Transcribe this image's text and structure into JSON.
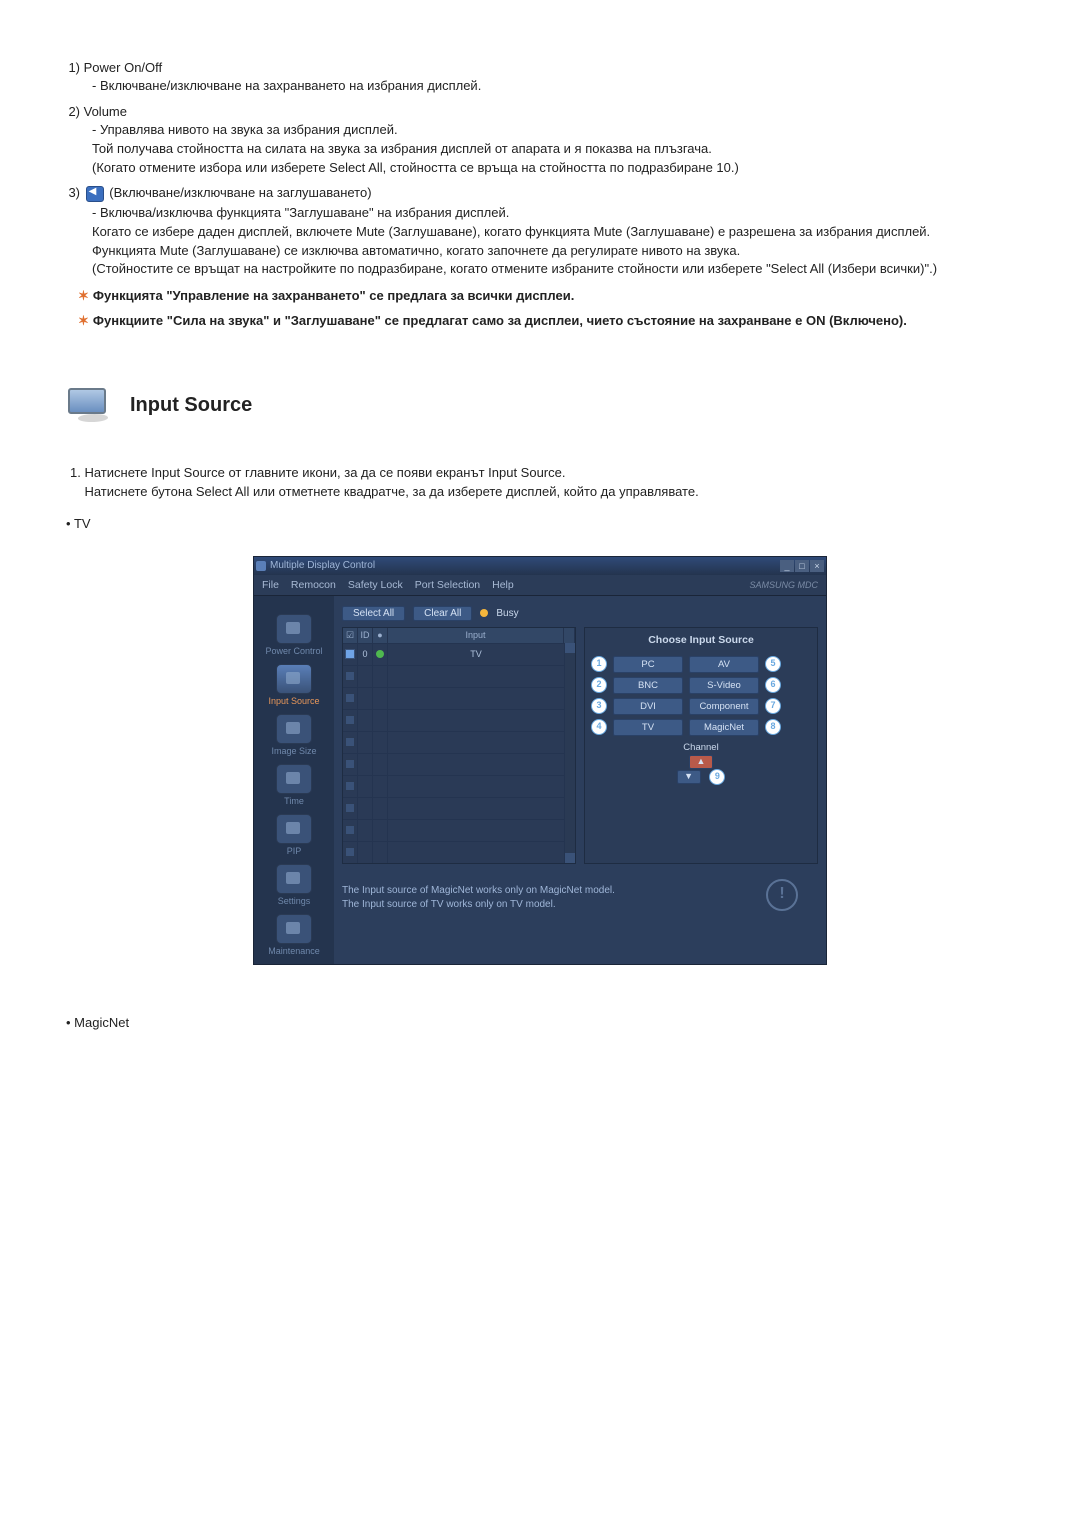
{
  "list": {
    "item1": {
      "num": "1)",
      "title": "Power On/Off",
      "desc": "- Включване/изключване на захранването на избрания дисплей."
    },
    "item2": {
      "num": "2)",
      "title": "Volume",
      "line1": "- Управлява нивото на звука за избрания дисплей.",
      "line2": "Той получава стойността на силата на звука за избрания дисплей от апарата и я показва на плъзгача.",
      "line3": "(Когато отмените избора или изберете Select All, стойността се връща на стойността по подразбиране 10.)"
    },
    "item3": {
      "num": "3)",
      "title": "(Включване/изключване на заглушаването)",
      "line1": "- Включва/изключва функцията \"Заглушаване\" на избрания дисплей.",
      "line2": "Когато се избере даден дисплей, включете Mute (Заглушаване), когато функцията Mute (Заглушаване) е разрешена за избрания дисплей.",
      "line3": "Функцията Mute (Заглушаване) се изключва автоматично, когато започнете да регулирате нивото на звука.",
      "line4": "(Стойностите се връщат на настройките по подразбиране, когато отмените избраните стойности или изберете \"Select All (Избери всички)\".)"
    }
  },
  "notes": {
    "n1": "Функцията \"Управление на захранването\" се предлага за всички дисплеи.",
    "n2": "Функциите \"Сила на звука\" и \"Заглушаване\" се предлагат само за дисплеи, чието състояние на захранване е ON (Включено)."
  },
  "section": {
    "title": "Input Source"
  },
  "instructions": {
    "num": "1.",
    "line1": "Натиснете Input Source от главните икони, за да се появи екранът Input Source.",
    "line2": "Натиснете бутона Select All или отметнете квадратче, за да изберете дисплей, който да управлявате."
  },
  "bullets": {
    "tv": "TV",
    "magicnet": "MagicNet"
  },
  "screenshot": {
    "titlebar": "Multiple Display Control",
    "menu": {
      "file": "File",
      "remocon": "Remocon",
      "safety": "Safety Lock",
      "port": "Port Selection",
      "help": "Help"
    },
    "brand": "SAMSUNG MDC",
    "sidebar": {
      "power": "Power Control",
      "input": "Input Source",
      "image": "Image Size",
      "time": "Time",
      "pip": "PIP",
      "settings": "Settings",
      "maintenance": "Maintenance"
    },
    "toolbar": {
      "select": "Select All",
      "clear": "Clear All",
      "busy": "Busy"
    },
    "table": {
      "th_id": "ID",
      "th_input": "Input",
      "row0_id": "0",
      "row0_input": "TV"
    },
    "panel": {
      "title": "Choose Input Source",
      "pc": "PC",
      "bnc": "BNC",
      "dvi": "DVI",
      "tv": "TV",
      "av": "AV",
      "svideo": "S-Video",
      "component": "Component",
      "magicnet": "MagicNet",
      "channel": "Channel"
    },
    "markers": {
      "m1": "1",
      "m2": "2",
      "m3": "3",
      "m4": "4",
      "m5": "5",
      "m6": "6",
      "m7": "7",
      "m8": "8",
      "m9": "9"
    },
    "notes": {
      "l1": "The Input source of MagicNet works only on MagicNet model.",
      "l2": "The Input source of TV works only on TV model."
    }
  }
}
